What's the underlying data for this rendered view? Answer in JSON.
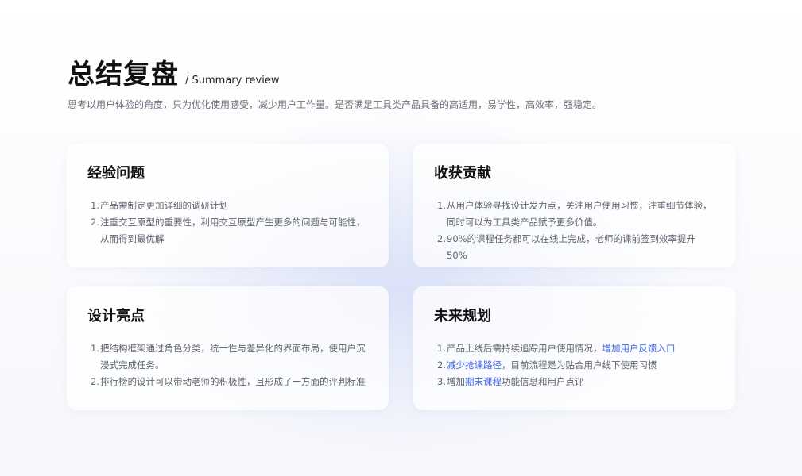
{
  "header": {
    "title": "总结复盘",
    "subtitle": "/ Summary review",
    "description": "思考以用户体验的角度，只为优化使用感受，减少用户工作量。是否满足工具类产品具备的高适用，易学性，高效率，强稳定。"
  },
  "cards": {
    "experience": {
      "title": "经验问题",
      "items": [
        {
          "num": "1.",
          "text": "产品需制定更加详细的调研计划"
        },
        {
          "num": "2.",
          "text": "注重交互原型的重要性，利用交互原型产生更多的问题与可能性，从而得到最优解"
        }
      ]
    },
    "harvest": {
      "title": "收获贡献",
      "items": [
        {
          "num": "1.",
          "text": "从用户体验寻找设计发力点，关注用户使用习惯，注重细节体验，同时可以为工具类产品赋予更多价值。"
        },
        {
          "num": "2.",
          "text": "90%的课程任务都可以在线上完成，老师的课前签到效率提升50%"
        }
      ]
    },
    "design": {
      "title": "设计亮点",
      "items": [
        {
          "num": "1.",
          "text": "把结构框架通过角色分类，统一性与差异化的界面布局，使用户沉浸式完成任务。"
        },
        {
          "num": "2.",
          "text": "排行榜的设计可以带动老师的积极性，且形成了一方面的评判标准"
        }
      ]
    },
    "future": {
      "title": "未来规划",
      "items": [
        {
          "num": "1.",
          "pre": "产品上线后需持续追踪用户使用情况，",
          "hl": "增加用户反馈入口",
          "post": ""
        },
        {
          "num": "2.",
          "pre": "",
          "hl": "减少抢课路径",
          "post": "，目前流程是为贴合用户线下使用习惯"
        },
        {
          "num": "3.",
          "pre": "增加",
          "hl": "期末课程",
          "post": "功能信息和用户点评"
        }
      ]
    }
  },
  "colors": {
    "highlight": "#3c64e6",
    "text": "#5f636d",
    "title": "#111111"
  }
}
